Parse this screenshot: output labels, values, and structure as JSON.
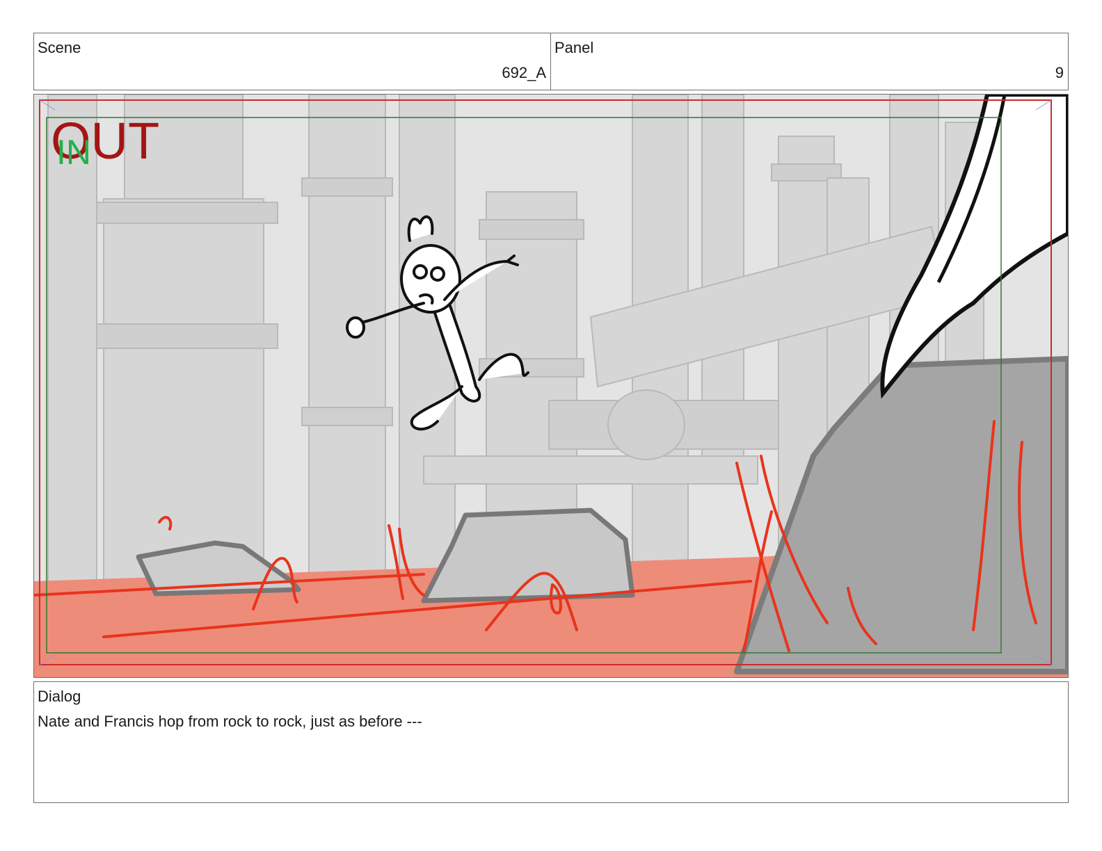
{
  "header": {
    "scene_label": "Scene",
    "scene_value": "692_A",
    "panel_label": "Panel",
    "panel_value": "9"
  },
  "frame": {
    "overlay_out": "OUT",
    "overlay_in": "IN",
    "colors": {
      "out_marker": "#a31515",
      "in_marker": "#22b14c",
      "floor": "#ee8c7a",
      "lava_strokes": "#e8341c",
      "pipes": "#d7d7d7",
      "rocks": "#a8a8a8",
      "safe_area": "#2f7a2f",
      "frame_border": "#cc2a2a"
    }
  },
  "dialog": {
    "label": "Dialog",
    "text": "Nate and Francis hop from rock to rock, just as before ---"
  }
}
